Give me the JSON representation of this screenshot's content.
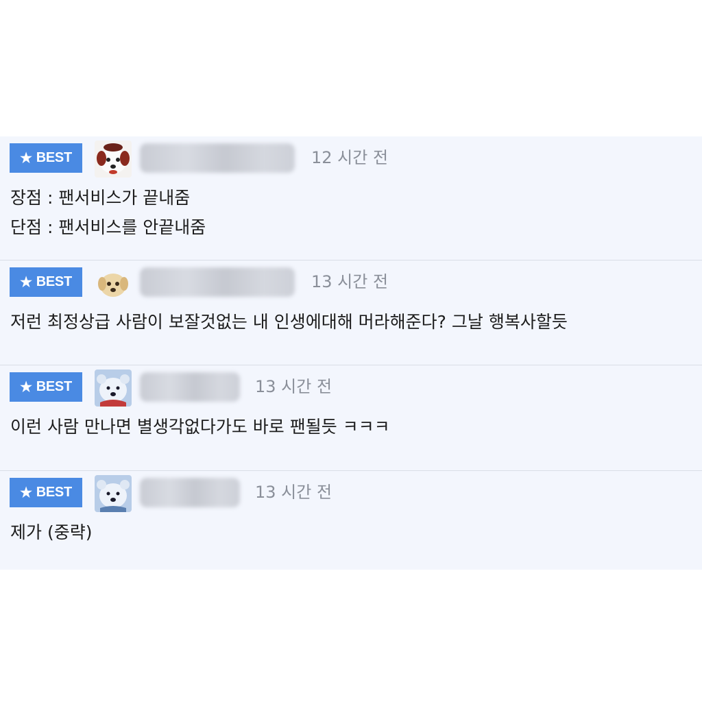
{
  "comments": [
    {
      "badge": "BEST",
      "username": "",
      "time": "12 시간 전",
      "lines": [
        "장점 : 팬서비스가 끝내줌",
        "단점 : 팬서비스를 안끝내줌"
      ],
      "avatar": "puppy-red-avatar"
    },
    {
      "badge": "BEST",
      "username": "",
      "time": "13 시간 전",
      "lines": [
        "저런 최정상급 사람이 보잘것없는 내 인생에대해 머라해준다? 그날 행복사할듯"
      ],
      "avatar": "puppy-tan-avatar"
    },
    {
      "badge": "BEST",
      "username": "",
      "time": "13 시간 전",
      "lines": [
        "이런 사람 만나면 별생각없다가도 바로 팬될듯 ㅋㅋㅋ"
      ],
      "avatar": "polar-bear-avatar"
    },
    {
      "badge": "BEST",
      "username": "",
      "time": "13 시간 전",
      "lines": [
        "제가 (중략)"
      ],
      "avatar": "polar-bear-avatar"
    }
  ],
  "colors": {
    "badge": "#4a8ae3",
    "background": "#f3f6fd",
    "divider": "#d9dde6",
    "timestamp": "#8a8f99"
  }
}
